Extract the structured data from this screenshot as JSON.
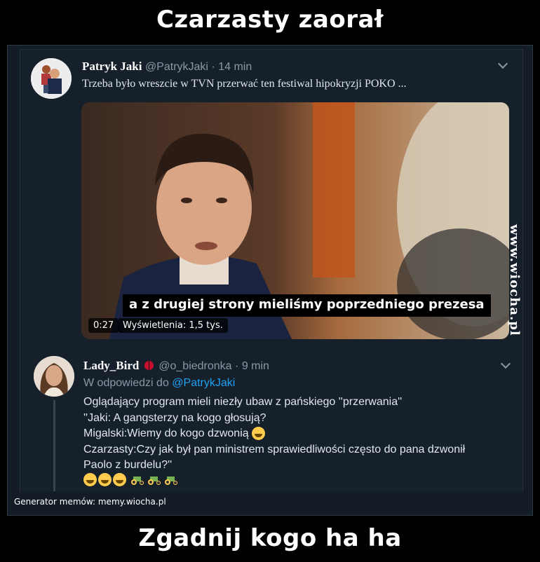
{
  "meme": {
    "top_caption": "Czarzasty zaorał",
    "bottom_caption": "Zgadnij kogo ha ha",
    "watermark": "www.wiocha.pl",
    "generator": "Generator memów:  memy.wiocha.pl"
  },
  "tweet": {
    "display_name": "Patryk Jaki",
    "handle": "@PatrykJaki",
    "separator": "·",
    "time": "14 min",
    "text": "Trzeba było wreszcie w TVN przerwać ten festiwal hipokryzji POKO ...",
    "video": {
      "subtitle": "a z drugiej strony mieliśmy poprzedniego prezesa",
      "duration": "0:27",
      "views": "Wyświetlenia: 1,5 tys."
    }
  },
  "reply": {
    "display_name": "Lady_Bird",
    "handle": "@o_biedronka",
    "separator": "·",
    "time": "9 min",
    "reply_prefix": "W odpowiedzi do",
    "reply_to": "@PatrykJaki",
    "lines": [
      "Oglądający program mieli niezły ubaw z pańskiego ''przerwania''",
      "''Jaki: A gangsterzy na kogo głosują?",
      "Migalski:Wiemy do kogo dzwonią",
      "Czarzasty:Czy jak był pan ministrem sprawiedliwości często do pana dzwonił",
      "Paolo z burdelu?''"
    ],
    "icons": [
      "ladybug-icon",
      "laughing-emoji-icon",
      "tractor-emoji-icon"
    ]
  },
  "colors": {
    "background": "#000000",
    "card": "#15202b",
    "muted_text": "#8899a6",
    "link": "#1da1f2"
  }
}
